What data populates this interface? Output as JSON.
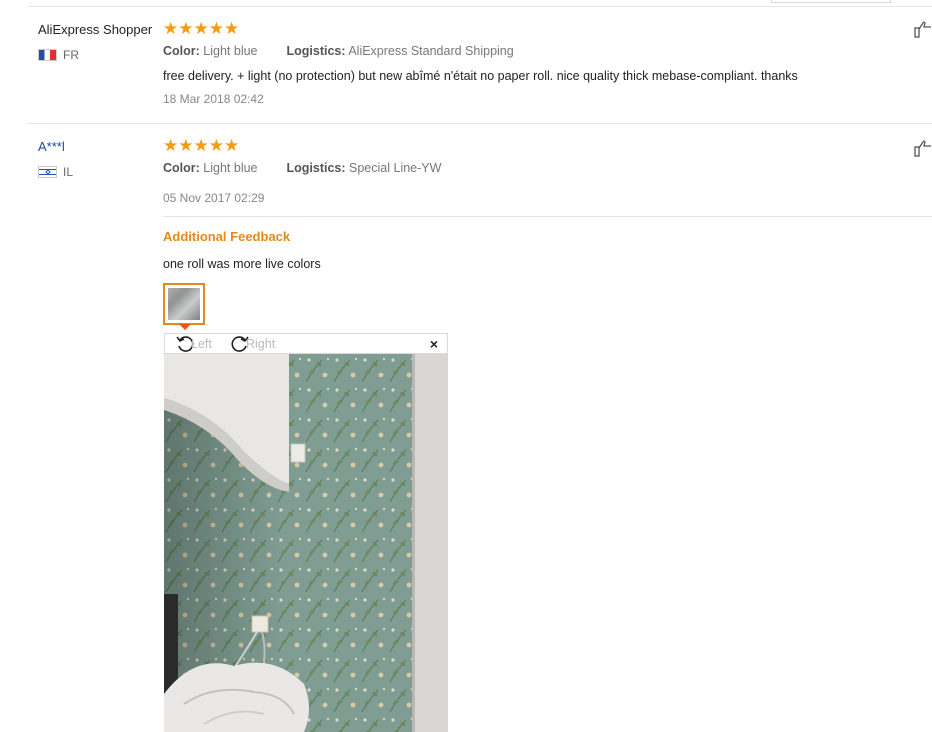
{
  "reviews": [
    {
      "name": "AliExpress Shopper",
      "country": "FR",
      "rating": 5,
      "color_label": "Color:",
      "color_value": "Light blue",
      "logistics_label": "Logistics:",
      "logistics_value": "AliExpress Standard Shipping",
      "text": "free delivery. + light (no protection) but new abîmé n'était no paper roll. nice quality thick mebase-compliant. thanks",
      "date": "18 Mar 2018 02:42"
    },
    {
      "name": "A***l",
      "country": "IL",
      "rating": 5,
      "color_label": "Color:",
      "color_value": "Light blue",
      "logistics_label": "Logistics:",
      "logistics_value": "Special Line-YW",
      "date": "05 Nov 2017 02:29",
      "additional_feedback_title": "Additional Feedback",
      "additional_feedback_text": "one roll was more live colors"
    }
  ],
  "image_viewer": {
    "rotate_left_label": "Left",
    "rotate_right_label": "Right",
    "close_symbol": "×"
  },
  "icons": {
    "star": "star-icon",
    "thumbs_up": "thumbs-up-icon",
    "rotate_left": "rotate-left-icon",
    "rotate_right": "rotate-right-icon",
    "close": "close-icon"
  },
  "colors": {
    "star": "#f39c12",
    "accent": "#e38a1c",
    "link": "#1a4c94"
  }
}
